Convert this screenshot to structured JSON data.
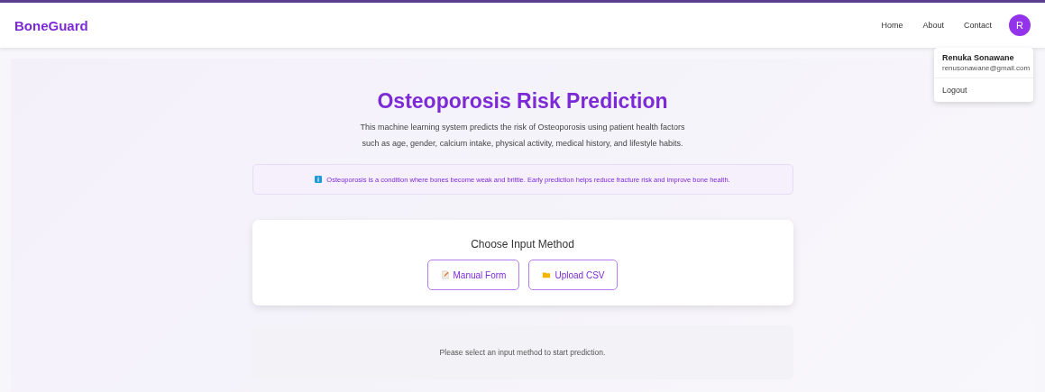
{
  "navbar": {
    "brand": "BoneGuard",
    "links": [
      "Home",
      "About",
      "Contact"
    ],
    "avatar": "R"
  },
  "user_menu": {
    "name": "Renuka Sonawane",
    "email": "renusonawane@gmail.com",
    "items": [
      "Logout"
    ]
  },
  "hero": {
    "title": "Osteoporosis Risk Prediction",
    "description": [
      "This machine learning system predicts the risk of Osteoporosis using patient health factors",
      "such as age, gender, calcium intake, physical activity, medical history, and lifestyle habits."
    ]
  },
  "info_banner": "Osteoporosis is a condition where bones become weak and brittle. Early prediction helps reduce fracture risk and improve bone health.",
  "input_method": {
    "title": "Choose Input Method",
    "buttons": [
      {
        "kind": "form",
        "label": "Manual Form"
      },
      {
        "kind": "upload",
        "label": "Upload CSV"
      }
    ]
  },
  "result_placeholder": "Please select an input method to start prediction."
}
